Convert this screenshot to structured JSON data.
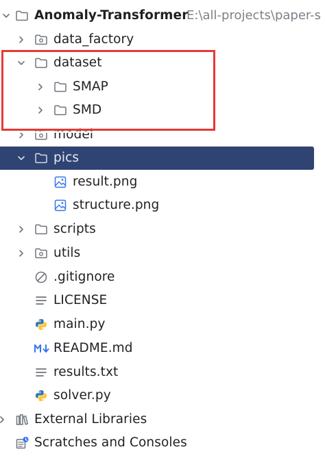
{
  "project": {
    "name": "Anomaly-Transformer",
    "path": "E:\\all-projects\\paper-s"
  },
  "tree": {
    "data_factory": "data_factory",
    "dataset": "dataset",
    "smap": "SMAP",
    "smd": "SMD",
    "model": "model",
    "pics": "pics",
    "result_png": "result.png",
    "structure_png": "structure.png",
    "scripts": "scripts",
    "utils": "utils",
    "gitignore": ".gitignore",
    "license": "LICENSE",
    "main_py": "main.py",
    "readme": "README.md",
    "results_txt": "results.txt",
    "solver_py": "solver.py"
  },
  "bottom": {
    "external_libraries": "External Libraries",
    "scratches": "Scratches and Consoles"
  },
  "icons": {
    "folder": "folder-icon",
    "module_folder": "module-folder-icon",
    "image_file": "image-file-icon",
    "ignore_file": "ignore-file-icon",
    "text_file": "text-file-icon",
    "python_file": "python-file-icon",
    "markdown_file": "markdown-file-icon",
    "library": "library-icon",
    "scratches": "scratches-icon"
  },
  "colors": {
    "selection": "#2f4472",
    "annotation_box": "#e53a35",
    "image_icon": "#3574f0",
    "python_blue": "#3776ab",
    "python_yellow": "#ffc331",
    "path_text": "#7d8088"
  }
}
